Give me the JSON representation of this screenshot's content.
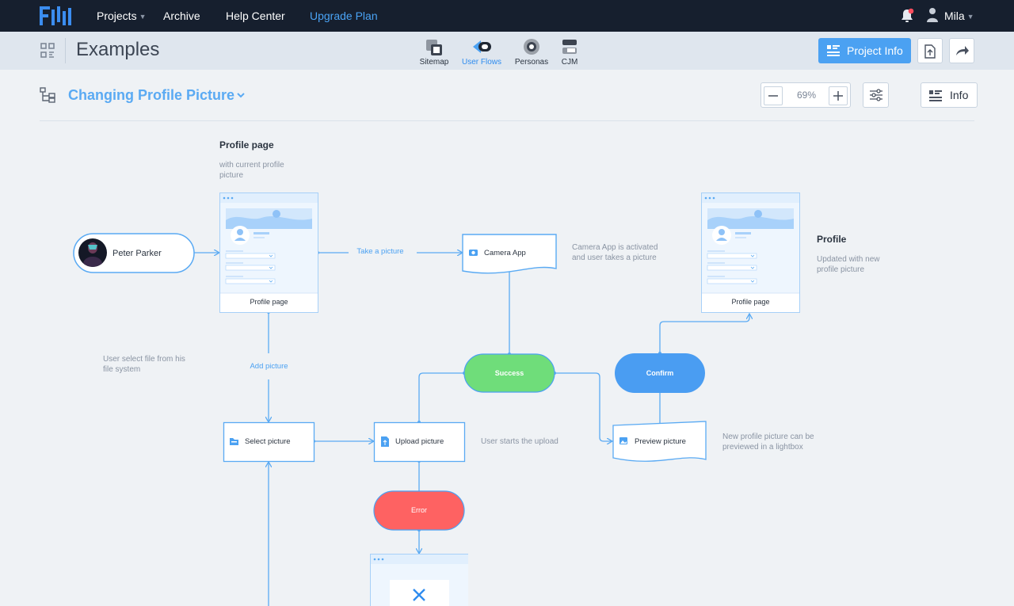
{
  "nav": {
    "projects": "Projects",
    "archive": "Archive",
    "help": "Help Center",
    "upgrade": "Upgrade Plan",
    "user": "Mila"
  },
  "subheader": {
    "title": "Examples",
    "tabs": [
      {
        "label": "Sitemap"
      },
      {
        "label": "User Flows"
      },
      {
        "label": "Personas"
      },
      {
        "label": "CJM"
      }
    ],
    "project_info": "Project Info"
  },
  "flow": {
    "title": "Changing Profile Picture",
    "zoom": "69%",
    "info": "Info"
  },
  "colors": {
    "accent": "#4ba1f2",
    "success": "#6fdd7a",
    "error": "#fe6262",
    "confirm": "#4a9df2",
    "line": "#5aaaf3"
  },
  "diagram": {
    "profile_page_heading": "Profile page",
    "profile_page_desc_1": "with current profile",
    "profile_page_desc_2": "picture",
    "person": "Peter Parker",
    "profile_card_label": "Profile page",
    "take_picture": "Take a picture",
    "camera_app": "Camera App",
    "camera_desc_1": "Camera App is activated",
    "camera_desc_2": "and user takes a picture",
    "result_heading": "Profile",
    "result_desc_1": "Updated with new",
    "result_desc_2": "profile picture",
    "result_card_label": "Profile page",
    "file_desc_1": "User select file from his",
    "file_desc_2": "file system",
    "add_picture": "Add picture",
    "success": "Success",
    "confirm": "Confirm",
    "select_picture": "Select picture",
    "upload_picture": "Upload picture",
    "upload_desc": "User starts the upload",
    "preview_picture": "Preview picture",
    "preview_desc_1": "New profile picture can be",
    "preview_desc_2": "previewed in a lightbox",
    "error": "Error"
  }
}
